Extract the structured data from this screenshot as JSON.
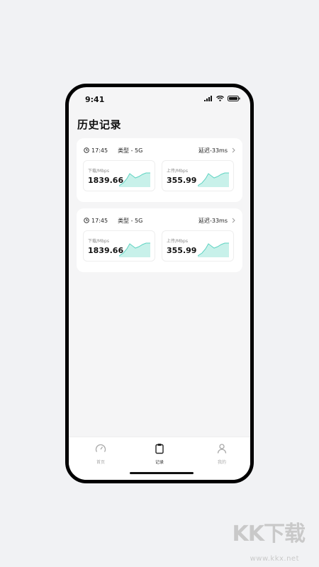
{
  "status_bar": {
    "time": "9:41"
  },
  "page_title": "历史记录",
  "records": [
    {
      "time": "17:45",
      "type": "类型 - 5G",
      "latency": "延迟-33ms",
      "download": {
        "label": "下载/Mbps",
        "value": "1839.66"
      },
      "upload": {
        "label": "上传/Mbps",
        "value": "355.99"
      }
    },
    {
      "time": "17:45",
      "type": "类型 - 5G",
      "latency": "延迟-33ms",
      "download": {
        "label": "下载/Mbps",
        "value": "1839.66"
      },
      "upload": {
        "label": "上传/Mbps",
        "value": "355.99"
      }
    }
  ],
  "tabbar": {
    "items": [
      {
        "label": "首页",
        "icon": "speedometer-icon"
      },
      {
        "label": "记录",
        "icon": "clipboard-icon",
        "active": true
      },
      {
        "label": "我的",
        "icon": "user-icon"
      }
    ]
  },
  "watermark": {
    "text": "KK下载",
    "url": "www.kkx.net"
  },
  "colors": {
    "chart_line": "#5fd3c2",
    "chart_fill": "#c8f1ea",
    "background": "#f5f5f6"
  }
}
